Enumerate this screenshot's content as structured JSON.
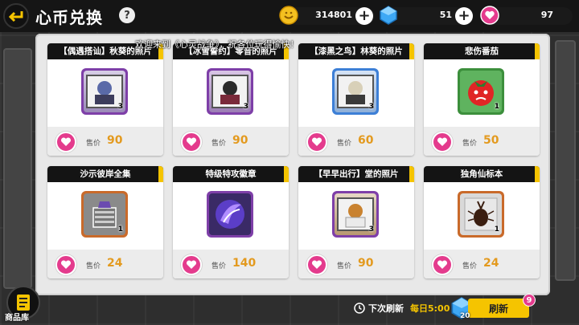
{
  "header": {
    "title": "心币兑换",
    "help": "?",
    "gold": "314801",
    "crystal": "51",
    "heart": "97"
  },
  "marquee": "欢迎来到《心灵战争》，祝各位玩得愉快！",
  "items": [
    {
      "name": "【偶遇搭讪】秋葵的照片",
      "price": "90",
      "qty": "3",
      "icon": "photo-icon"
    },
    {
      "name": "【冰雪誓约】零音的照片",
      "price": "90",
      "qty": "3",
      "icon": "photo-icon"
    },
    {
      "name": "【漆黑之鸟】林葵的照片",
      "price": "60",
      "qty": "3",
      "icon": "photo-icon"
    },
    {
      "name": "悲伤番茄",
      "price": "50",
      "qty": "1",
      "icon": "tomato-icon"
    },
    {
      "name": "沙示彼岸全集",
      "price": "24",
      "qty": "1",
      "icon": "book-icon"
    },
    {
      "name": "特级特攻徽章",
      "price": "140",
      "qty": "",
      "icon": "badge-icon"
    },
    {
      "name": "【早早出行】堂的照片",
      "price": "90",
      "qty": "3",
      "icon": "photo-icon"
    },
    {
      "name": "独角仙标本",
      "price": "24",
      "qty": "1",
      "icon": "beetle-icon"
    }
  ],
  "price_label": "售价",
  "footer": {
    "shop_label": "商品库",
    "refresh_prefix": "下次刷新",
    "refresh_time": "每日5:00",
    "refresh_cost": "20",
    "refresh_button": "刷新",
    "refresh_badge": "9"
  },
  "colors": {
    "accent": "#f5c400",
    "heart": "#e43b8d",
    "price": "#e39a1f"
  }
}
